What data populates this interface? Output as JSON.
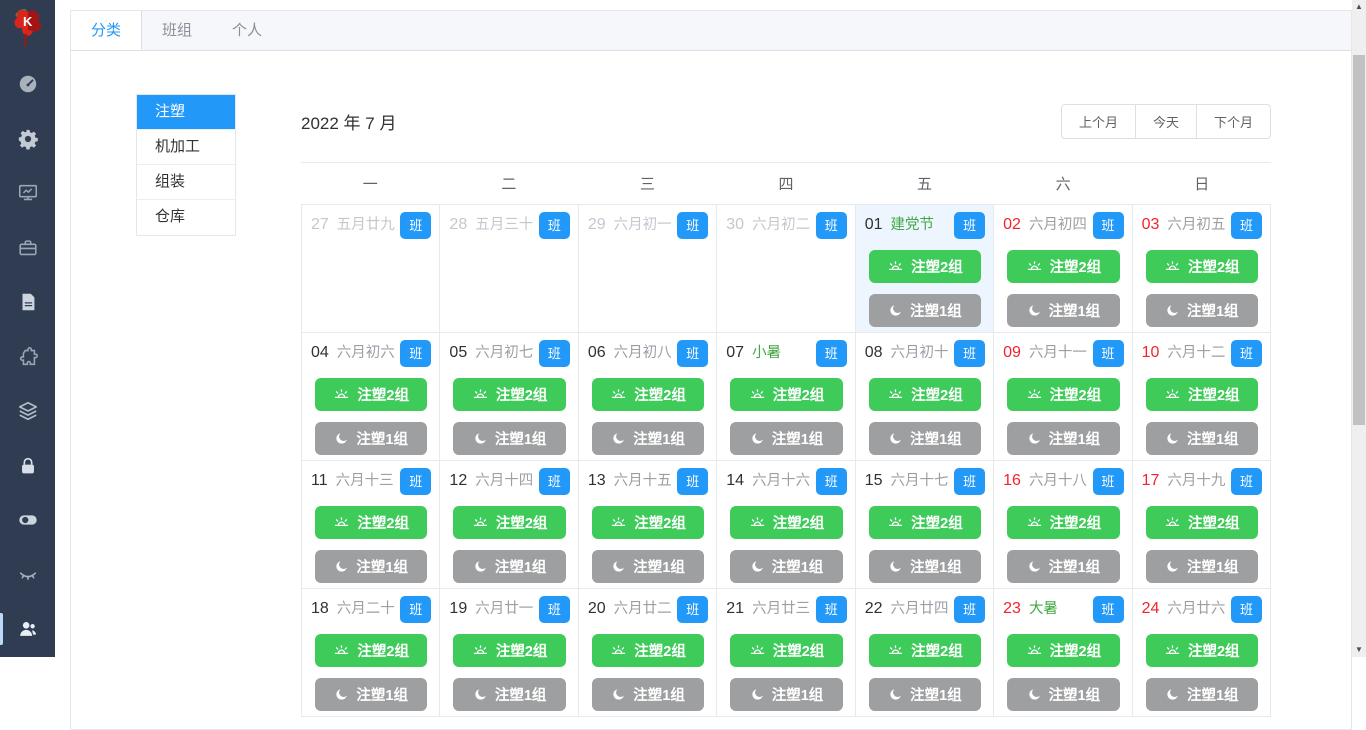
{
  "sidebar": {
    "icons": [
      "dashboard-icon",
      "gear-icon",
      "monitor-chart-icon",
      "briefcase-icon",
      "document-icon",
      "puzzle-icon",
      "layers-icon",
      "lock-icon",
      "toggle-icon",
      "eye-closed-icon",
      "users-icon"
    ]
  },
  "tabs": [
    {
      "label": "分类",
      "active": true
    },
    {
      "label": "班组",
      "active": false
    },
    {
      "label": "个人",
      "active": false
    }
  ],
  "categories": [
    {
      "label": "注塑",
      "active": true
    },
    {
      "label": "机加工",
      "active": false
    },
    {
      "label": "组装",
      "active": false
    },
    {
      "label": "仓库",
      "active": false
    }
  ],
  "calendar": {
    "title": "2022 年 7 月",
    "nav": {
      "prev": "上个月",
      "today": "今天",
      "next": "下个月"
    },
    "weekdays": [
      "一",
      "二",
      "三",
      "四",
      "五",
      "六",
      "日"
    ],
    "badge": "班",
    "day_shift": "注塑2组",
    "night_shift": "注塑1组",
    "icons": {
      "day": "sunrise-icon",
      "night": "moon-icon"
    },
    "weeks": [
      [
        {
          "day": "27",
          "lunar": "五月廿九",
          "prev": true
        },
        {
          "day": "28",
          "lunar": "五月三十",
          "prev": true
        },
        {
          "day": "29",
          "lunar": "六月初一",
          "prev": true
        },
        {
          "day": "30",
          "lunar": "六月初二",
          "prev": true
        },
        {
          "day": "01",
          "lunar": "建党节",
          "festival": true,
          "highlight": true,
          "shifts": true
        },
        {
          "day": "02",
          "lunar": "六月初四",
          "weekend": true,
          "shifts": true
        },
        {
          "day": "03",
          "lunar": "六月初五",
          "weekend": true,
          "shifts": true
        }
      ],
      [
        {
          "day": "04",
          "lunar": "六月初六",
          "shifts": true
        },
        {
          "day": "05",
          "lunar": "六月初七",
          "shifts": true
        },
        {
          "day": "06",
          "lunar": "六月初八",
          "shifts": true
        },
        {
          "day": "07",
          "lunar": "小暑",
          "festival": true,
          "shifts": true
        },
        {
          "day": "08",
          "lunar": "六月初十",
          "shifts": true
        },
        {
          "day": "09",
          "lunar": "六月十一",
          "weekend": true,
          "shifts": true
        },
        {
          "day": "10",
          "lunar": "六月十二",
          "weekend": true,
          "shifts": true
        }
      ],
      [
        {
          "day": "11",
          "lunar": "六月十三",
          "shifts": true
        },
        {
          "day": "12",
          "lunar": "六月十四",
          "shifts": true
        },
        {
          "day": "13",
          "lunar": "六月十五",
          "shifts": true
        },
        {
          "day": "14",
          "lunar": "六月十六",
          "shifts": true
        },
        {
          "day": "15",
          "lunar": "六月十七",
          "shifts": true
        },
        {
          "day": "16",
          "lunar": "六月十八",
          "weekend": true,
          "shifts": true
        },
        {
          "day": "17",
          "lunar": "六月十九",
          "weekend": true,
          "shifts": true
        }
      ],
      [
        {
          "day": "18",
          "lunar": "六月二十",
          "shifts": true
        },
        {
          "day": "19",
          "lunar": "六月廿一",
          "shifts": true
        },
        {
          "day": "20",
          "lunar": "六月廿二",
          "shifts": true
        },
        {
          "day": "21",
          "lunar": "六月廿三",
          "shifts": true
        },
        {
          "day": "22",
          "lunar": "六月廿四",
          "shifts": true
        },
        {
          "day": "23",
          "lunar": "大暑",
          "festival": true,
          "weekend": true,
          "shifts": true
        },
        {
          "day": "24",
          "lunar": "六月廿六",
          "weekend": true,
          "shifts": true
        }
      ]
    ]
  },
  "colors": {
    "accent_blue": "#2299f8",
    "day_shift_green": "#3ecb5a",
    "night_shift_gray": "#9e9fa1",
    "weekend_red": "#f5222d",
    "festival_green": "#43a843",
    "highlight_cell": "#edf6fe",
    "sidebar_bg": "#2f3c52"
  }
}
